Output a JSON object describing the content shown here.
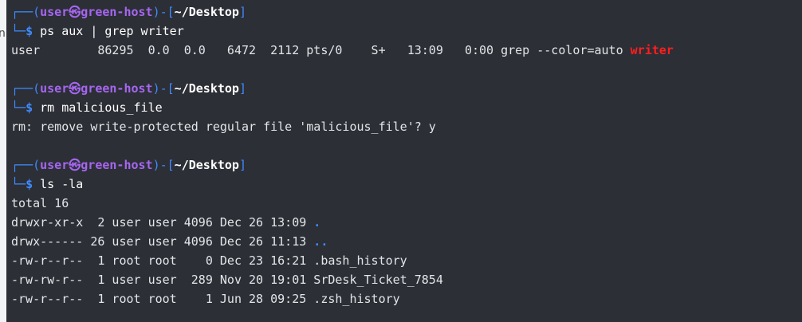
{
  "left_fragment": "n",
  "prompt": {
    "box_top": "┌──(",
    "user": "user",
    "at": "㉿",
    "host": "green-host",
    "mid": ")-[",
    "path": "~/Desktop",
    "end": "]",
    "box_bottom": "└─",
    "symbol": "$"
  },
  "block1": {
    "command": "ps aux | grep writer",
    "output_prefix": "user        86295  0.0  0.0   6472  2112 pts/0    S+   13:09   0:00 grep --color=auto ",
    "output_highlight": "writer"
  },
  "block2": {
    "command": "rm malicious_file",
    "output": "rm: remove write-protected regular file 'malicious_file'? y"
  },
  "block3": {
    "command": "ls -la",
    "total": "total 16",
    "entries": [
      {
        "meta": "drwxr-xr-x  2 user user 4096 Dec 26 13:09 ",
        "name": ".",
        "is_dir": true
      },
      {
        "meta": "drwx------ 26 user user 4096 Dec 26 11:13 ",
        "name": "..",
        "is_dir": true
      },
      {
        "meta": "-rw-r--r--  1 root root    0 Dec 23 16:21 ",
        "name": ".bash_history",
        "is_dir": false
      },
      {
        "meta": "-rw-rw-r--  1 user user  289 Nov 20 19:01 ",
        "name": "SrDesk_Ticket_7854",
        "is_dir": false
      },
      {
        "meta": "-rw-r--r--  1 root root    1 Jun 28 09:25 ",
        "name": ".zsh_history",
        "is_dir": false
      }
    ]
  },
  "colors": {
    "background": "#2c2f36",
    "prompt_frame": "#3f8bff",
    "user_host": "#a566f0",
    "highlight": "#ff1e1e",
    "directory": "#3f8bff"
  }
}
